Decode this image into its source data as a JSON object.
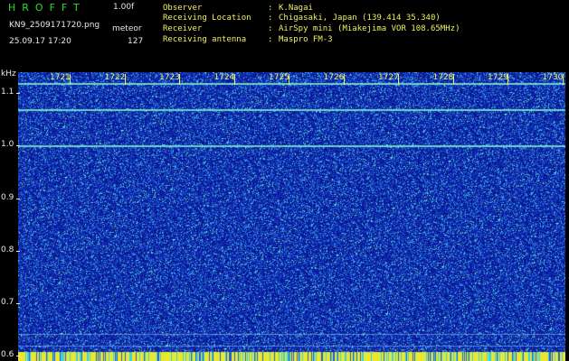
{
  "app": {
    "name": "HROFFT",
    "version": "1.00f",
    "filename": "KN9_2509171720.png",
    "file_type": "meteor",
    "datetime": "25.09.17 17:20",
    "count": "127"
  },
  "meta": [
    {
      "label": "Observer",
      "value": "K.Nagai"
    },
    {
      "label": "Receiving Location",
      "value": "Chigasaki, Japan (139.414 35.340)"
    },
    {
      "label": "Receiver",
      "value": "AirSpy mini (Miakejima VOR 108.65MHz)"
    },
    {
      "label": "Receiving antenna",
      "value": "Maspro FM-3"
    }
  ],
  "chart_data": {
    "type": "heatmap",
    "ylabel": "kHz",
    "y_ticks": [
      "1.1",
      "1.0",
      "0.9",
      "0.8",
      "0.7",
      "0.6"
    ],
    "x_ticks": [
      "1721",
      "1722",
      "1723",
      "1724",
      "1725",
      "1726",
      "1727",
      "1728",
      "1729",
      "1730"
    ],
    "ylim": [
      0.59,
      1.14
    ],
    "horizontal_lines_khz": [
      1.12,
      1.07,
      1.0
    ],
    "colors": {
      "background": "#0b1aa8",
      "noise_high": "#3cd2e6",
      "line": "#7ef0d0",
      "tick_label": "#f0f060"
    }
  }
}
